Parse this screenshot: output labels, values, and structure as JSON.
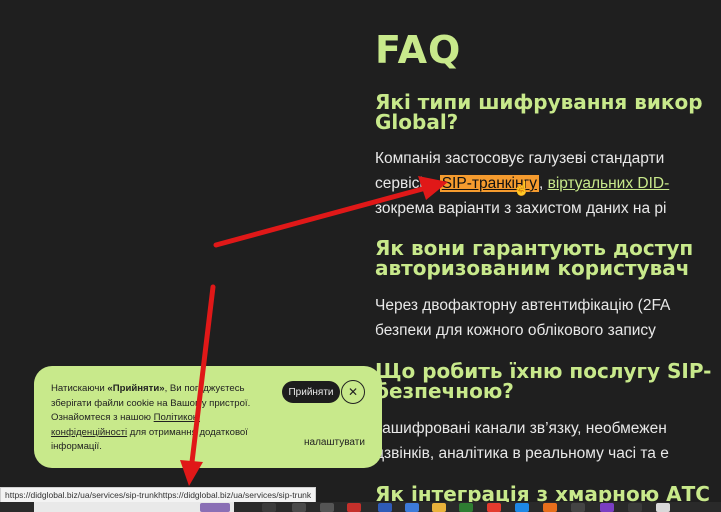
{
  "faq": {
    "title": "FAQ",
    "items": [
      {
        "question_lines": [
          "Які типи шифрування викор",
          "Global?"
        ],
        "answer_lines": [
          "Компанія застосовує галузеві стандарти",
          "сервісів: ",
          "зокрема варіанти з захистом даних на рі"
        ],
        "link_highlighted": "SIP-транкінгу",
        "link_separator": ", ",
        "link_second": "віртуальних DID-"
      },
      {
        "question_lines": [
          "Як вони гарантують доступ",
          "авторизованим користувач"
        ],
        "answer_lines": [
          "Через двофакторну автентифікацію (2FA",
          "безпеки для кожного облікового запису"
        ]
      },
      {
        "question_lines": [
          "Що робить їхню послугу SIP-",
          "безпечною?"
        ],
        "answer_lines": [
          "зашифровані канали зв’язку, необмежен",
          "дзвінків, аналітика в реальному часі та е"
        ]
      },
      {
        "question_lines": [
          "Як інтеграція з хмарною АТС"
        ]
      }
    ]
  },
  "cookie": {
    "text_intro": "Натискаючи ",
    "accept_word": "«Прийняти»",
    "text_mid": ", Ви погоджуєтесь зберігати файли cookie на Вашому пристрої. Ознайомтеся з нашою ",
    "policy_link": "Політикою конфіденційності",
    "text_end": " для отримання додаткової інформації.",
    "accept_button": "Прийняти",
    "close_symbol": "✕",
    "settings_link": "налаштувати"
  },
  "status_bar": {
    "url": "https://didglobal.biz/ua/services/sip-trunkhttps://didglobal.biz/ua/services/sip-trunk"
  },
  "colors": {
    "background": "#1f1f1f",
    "accent_green": "#c8e98b",
    "highlight_orange": "#f59b2e",
    "arrow_red": "#e01818"
  }
}
